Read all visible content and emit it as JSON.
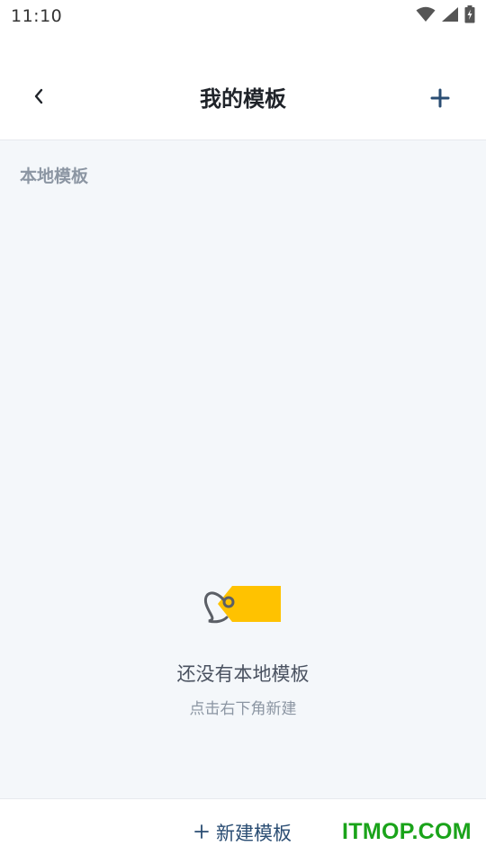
{
  "status_bar": {
    "time": "11:10",
    "icons": [
      "wifi-icon",
      "signal-icon",
      "battery-icon"
    ]
  },
  "header": {
    "back_icon": "chevron-left-icon",
    "title": "我的模板",
    "add_icon": "plus-icon"
  },
  "section": {
    "label": "本地模板"
  },
  "empty_state": {
    "illustration": "tag-icon",
    "title": "还没有本地模板",
    "subtitle": "点击右下角新建"
  },
  "bottom_bar": {
    "plus_icon": "plus-icon",
    "new_label": "新建模板"
  },
  "watermark": "ITMOP.COM",
  "colors": {
    "accent": "#2a4d73",
    "tag": "#ffc200",
    "background": "#f4f7fa",
    "watermark": "#1aa31a"
  }
}
